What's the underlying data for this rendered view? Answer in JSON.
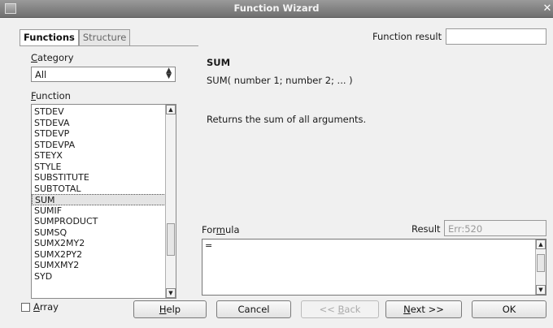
{
  "window": {
    "title": "Function Wizard"
  },
  "tabs": [
    {
      "label": "Functions",
      "active": true
    },
    {
      "label": "Structure",
      "active": false
    }
  ],
  "function_result": {
    "label": "Function result",
    "value": ""
  },
  "category": {
    "label_prefix": "",
    "label_key": "C",
    "label_rest": "ategory",
    "selected": "All"
  },
  "function_list": {
    "label_key": "F",
    "label_rest": "unction",
    "items": [
      "STDEV",
      "STDEVA",
      "STDEVP",
      "STDEVPA",
      "STEYX",
      "STYLE",
      "SUBSTITUTE",
      "SUBTOTAL",
      "SUM",
      "SUMIF",
      "SUMPRODUCT",
      "SUMSQ",
      "SUMX2MY2",
      "SUMX2PY2",
      "SUMXMY2",
      "SYD"
    ],
    "selected": "SUM"
  },
  "details": {
    "name": "SUM",
    "signature": "SUM( number 1; number 2; ...  )",
    "description": "Returns the sum of all arguments."
  },
  "formula": {
    "label_pre": "For",
    "label_key": "m",
    "label_rest": "ula",
    "value": "="
  },
  "result": {
    "label": "Result",
    "value": "Err:520"
  },
  "array": {
    "label_key": "A",
    "label_rest": "rray",
    "checked": false
  },
  "buttons": {
    "help": {
      "key": "H",
      "rest": "elp"
    },
    "cancel": "Cancel",
    "back": {
      "pre": "<< ",
      "key": "B",
      "rest": "ack"
    },
    "next": {
      "key": "N",
      "rest": "ext >>"
    },
    "ok": "OK"
  }
}
